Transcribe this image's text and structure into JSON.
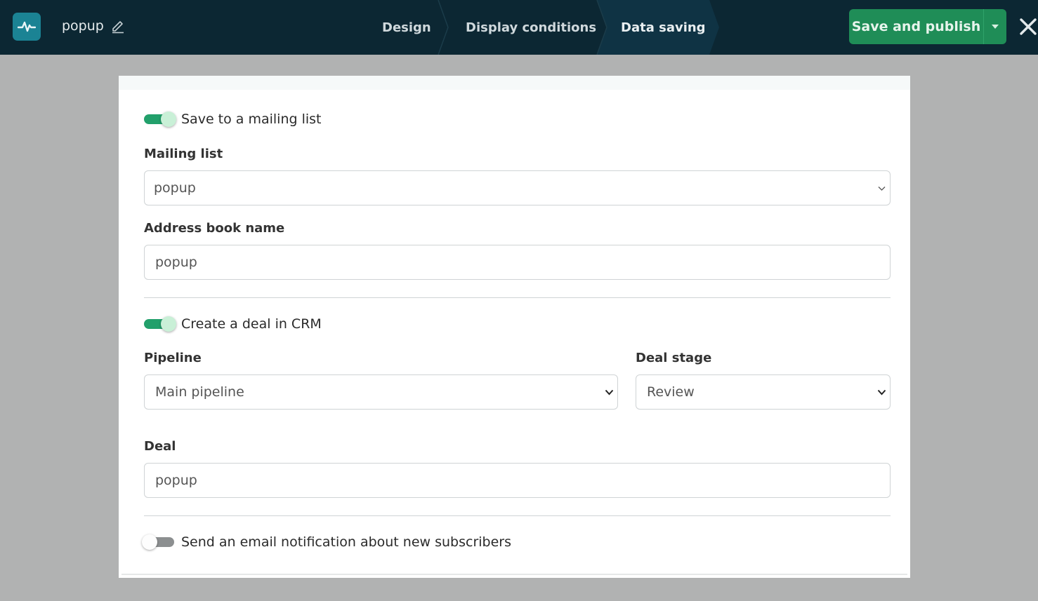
{
  "header": {
    "doc_title": "popup",
    "steps": [
      "Design",
      "Display conditions",
      "Data saving"
    ],
    "active_step": "Data saving",
    "publish_label": "Save and publish"
  },
  "colors": {
    "topbar": "#0c2733",
    "accent_green": "#1f8d57",
    "toggle_on": "#22a06b"
  },
  "icons": {
    "logo": "pulse-logo-icon",
    "edit": "pencil-icon",
    "close": "close-icon",
    "caret": "caret-down-icon",
    "chevron": "chevron-down-icon"
  },
  "mailing": {
    "toggle_label": "Save to a mailing list",
    "toggle_on": true,
    "list_label": "Mailing list",
    "list_value": "popup",
    "address_label": "Address book name",
    "address_value": "popup"
  },
  "crm": {
    "toggle_label": "Create a deal in CRM",
    "toggle_on": true,
    "pipeline_label": "Pipeline",
    "pipeline_value": "Main pipeline",
    "stage_label": "Deal stage",
    "stage_value": "Review",
    "deal_label": "Deal",
    "deal_value": "popup"
  },
  "notify": {
    "toggle_label": "Send an email notification about new subscribers",
    "toggle_on": false
  }
}
